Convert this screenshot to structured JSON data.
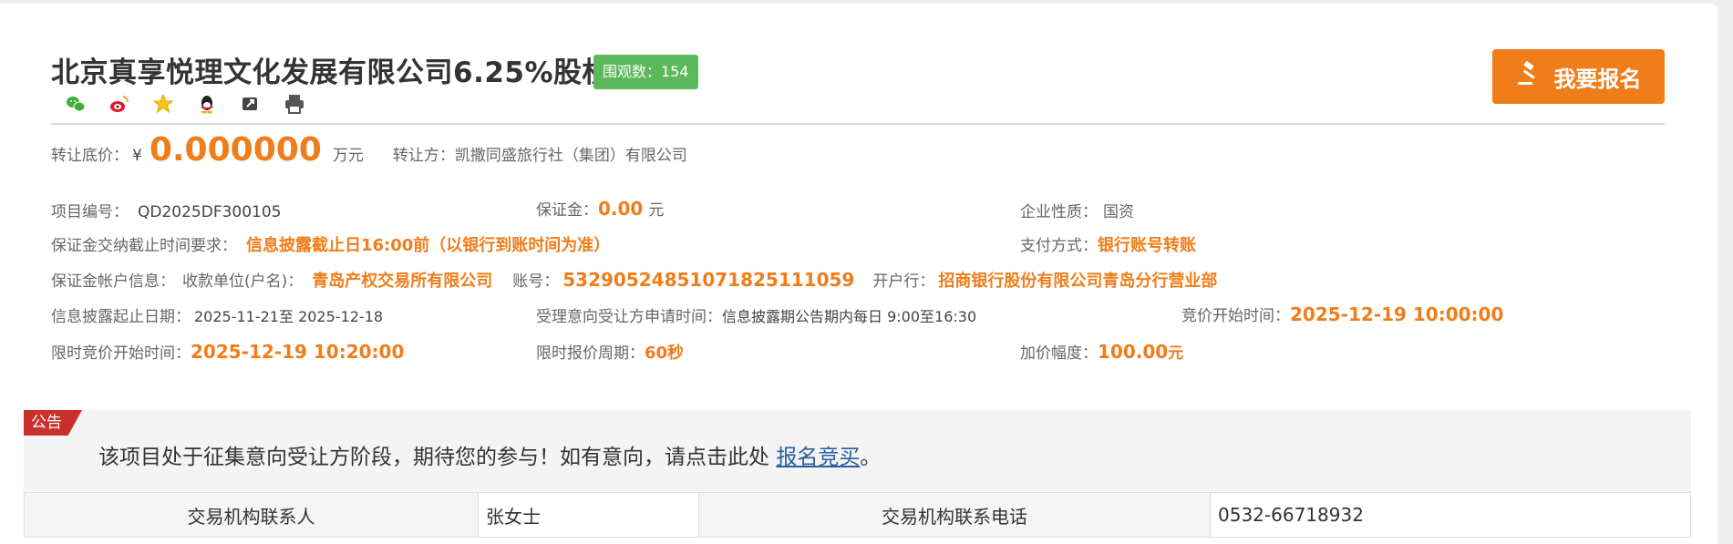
{
  "header": {
    "title": "北京真享悦理文化发展有限公司6.25%股权",
    "views_label": "围观数：154",
    "signup_button": "我要报名"
  },
  "share_icons": [
    "wechat-icon",
    "weibo-icon",
    "star-icon",
    "qq-icon",
    "link-icon",
    "print-icon"
  ],
  "price": {
    "label": "转让底价：",
    "currency": "¥",
    "amount": "0.000000",
    "unit": "万元",
    "transferor_label": "转让方：",
    "transferor": "凯撒同盛旅行社（集团）有限公司"
  },
  "details": {
    "project_no_label": "项目编号：",
    "project_no": "QD2025DF300105",
    "deposit_label": "保证金：",
    "deposit": "0.00",
    "deposit_unit": "元",
    "enterprise_type_label": "企业性质：",
    "enterprise_type": "国资",
    "deposit_deadline_label": "保证金交纳截止时间要求：",
    "deposit_deadline": "信息披露截止日16:00前（以银行到账时间为准）",
    "payment_label": "支付方式：",
    "payment": "银行账号转账",
    "account_info_label": "保证金帐户信息：",
    "payee_label": "收款单位(户名)：",
    "payee": "青岛产权交易所有限公司",
    "account_no_label": "账号：",
    "account_no": "532905248510718251110​59",
    "bank_label": "开户行：",
    "bank": "招商银行股份有限公司青岛分行营业部",
    "disclosure_label": "信息披露起止日期：",
    "disclosure": "2025-11-21至 2025-12-18",
    "application_time_label": "受理意向受让方申请时间：",
    "application_time": "信息披露期公告期内每日 9:00至16:30",
    "bid_start_label": "竞价开始时间：",
    "bid_start": "2025-12-19 10:00:00",
    "timed_bid_start_label": "限时竞价开始时间：",
    "timed_bid_start": "2025-12-19 10:20:00",
    "quote_period_label": "限时报价周期：",
    "quote_period": "60秒",
    "increment_label": "加价幅度：",
    "increment": "100.00",
    "increment_unit": "元"
  },
  "notice": {
    "tag": "公告",
    "text": "该项目处于征集意向受让方阶段，期待您的参与！如有意向，请点击此处 ",
    "link": "报名竞买",
    "end": "。"
  },
  "contact": {
    "person_label": "交易机构联系人",
    "person": "张女士",
    "phone_label": "交易机构联系电话",
    "phone": "0532-66718932"
  },
  "colors": {
    "accent": "#f07d1a",
    "views_badge": "#5cb85c",
    "notice_tag": "#c9302c",
    "link": "#2a5d9f"
  }
}
